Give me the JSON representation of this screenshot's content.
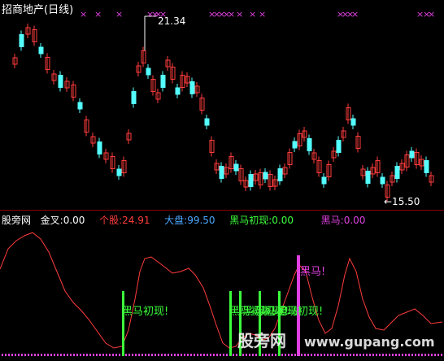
{
  "main_chart": {
    "title": "招商地产(日线)",
    "high_label": "21.34",
    "low_label": "←15.50",
    "colors": {
      "up": "#ff3c3c",
      "down": "#54ffff",
      "mark": "#e040e0",
      "line": "#ffffff"
    },
    "cross_marks": 22
  },
  "indicator": {
    "name": "股旁网",
    "items": [
      {
        "label": "金叉:",
        "value": "0.00",
        "color": "#ffffff"
      },
      {
        "label": "个股:",
        "value": "24.91",
        "color": "#ff3c3c"
      },
      {
        "label": "大盘:",
        "value": "99.50",
        "color": "#4aa8ff"
      },
      {
        "label": "黑马初现:",
        "value": "0.00",
        "color": "#3cff3c"
      },
      {
        "label": "黑马:",
        "value": "0.00",
        "color": "#e040e0"
      }
    ],
    "signal_texts": {
      "green": "黑马初现!",
      "magenta": "黑马!"
    },
    "colors": {
      "line": "#ff3c3c",
      "green": "#3cff3c",
      "magenta": "#e040e0"
    }
  },
  "watermark": {
    "cn": "股旁网",
    "url": "www.gupang.com"
  }
}
